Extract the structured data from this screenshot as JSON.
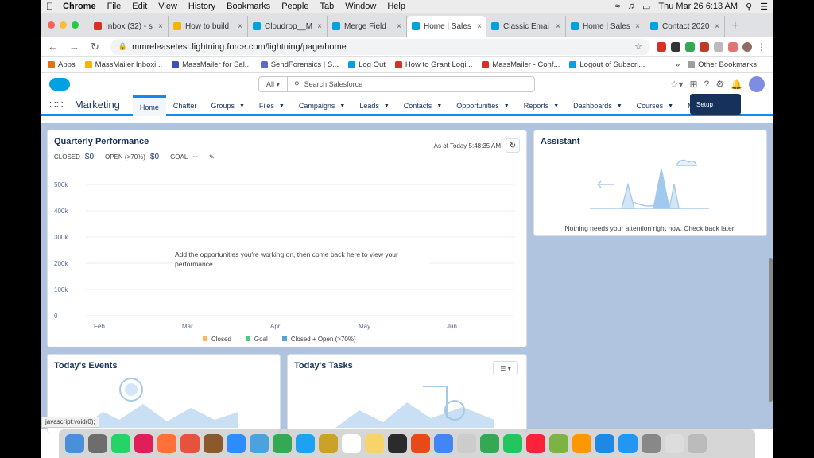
{
  "menubar": {
    "app": "Chrome",
    "items": [
      "File",
      "Edit",
      "View",
      "History",
      "Bookmarks",
      "People",
      "Tab",
      "Window",
      "Help"
    ],
    "clock": "Thu Mar 26  6:13 AM"
  },
  "tabs": [
    {
      "label": "Inbox (32) - s",
      "color": "#d93025"
    },
    {
      "label": "How to build",
      "color": "#f4b400"
    },
    {
      "label": "Cloudrop__M",
      "color": "#00a1e0"
    },
    {
      "label": "Merge Field",
      "color": "#00a1e0"
    },
    {
      "label": "Home | Sales",
      "color": "#00a1e0",
      "active": true
    },
    {
      "label": "Classic Emai",
      "color": "#00a1e0"
    },
    {
      "label": "Home | Sales",
      "color": "#00a1e0"
    },
    {
      "label": "Contact 2020",
      "color": "#00a1e0"
    }
  ],
  "address": {
    "url": "mmreleasetest.lightning.force.com/lightning/page/home"
  },
  "bookmarks": {
    "apps": "Apps",
    "items": [
      "MassMailer Inboxi...",
      "MassMailer for Sal...",
      "SendForensics | S...",
      "Log Out",
      "How to Grant Logi...",
      "MassMailer - Conf...",
      "Logout of Subscri..."
    ],
    "overflow": "»",
    "other": "Other Bookmarks"
  },
  "sf": {
    "search_scope": "All",
    "search_placeholder": "Search Salesforce",
    "setup_tooltip": "Setup",
    "app_name": "Marketing",
    "nav": [
      {
        "label": "Home",
        "active": true
      },
      {
        "label": "Chatter"
      },
      {
        "label": "Groups",
        "chev": true
      },
      {
        "label": "Files",
        "chev": true
      },
      {
        "label": "Campaigns",
        "chev": true
      },
      {
        "label": "Leads",
        "chev": true
      },
      {
        "label": "Contacts",
        "chev": true
      },
      {
        "label": "Opportunities",
        "chev": true
      },
      {
        "label": "Reports",
        "chev": true
      },
      {
        "label": "Dashboards",
        "chev": true
      },
      {
        "label": "Courses",
        "chev": true
      },
      {
        "label": "Mo"
      }
    ]
  },
  "quarterly": {
    "title": "Quarterly Performance",
    "closed_label": "CLOSED",
    "closed_value": "$0",
    "open_label": "OPEN (>70%)",
    "open_value": "$0",
    "goal_label": "GOAL",
    "goal_value": "--",
    "as_of": "As of Today 5:48:35 AM",
    "empty_message": "Add the opportunities you're working on, then come back here to view your performance."
  },
  "chart_data": {
    "type": "line",
    "categories": [
      "Feb",
      "Mar",
      "Apr",
      "May",
      "Jun"
    ],
    "y_ticks": [
      "500k",
      "400k",
      "300k",
      "200k",
      "100k",
      "0"
    ],
    "ylim": [
      0,
      500000
    ],
    "series": [
      {
        "name": "Closed",
        "color": "#ffb75d",
        "values": []
      },
      {
        "name": "Goal",
        "color": "#4bca81",
        "values": []
      },
      {
        "name": "Closed + Open (>70%)",
        "color": "#54a4d8",
        "values": []
      }
    ]
  },
  "assistant": {
    "title": "Assistant",
    "message": "Nothing needs your attention right now. Check back later."
  },
  "events": {
    "title": "Today's Events"
  },
  "tasks": {
    "title": "Today's Tasks",
    "filter_icon": "▾"
  },
  "status": "javascript:void(0);"
}
